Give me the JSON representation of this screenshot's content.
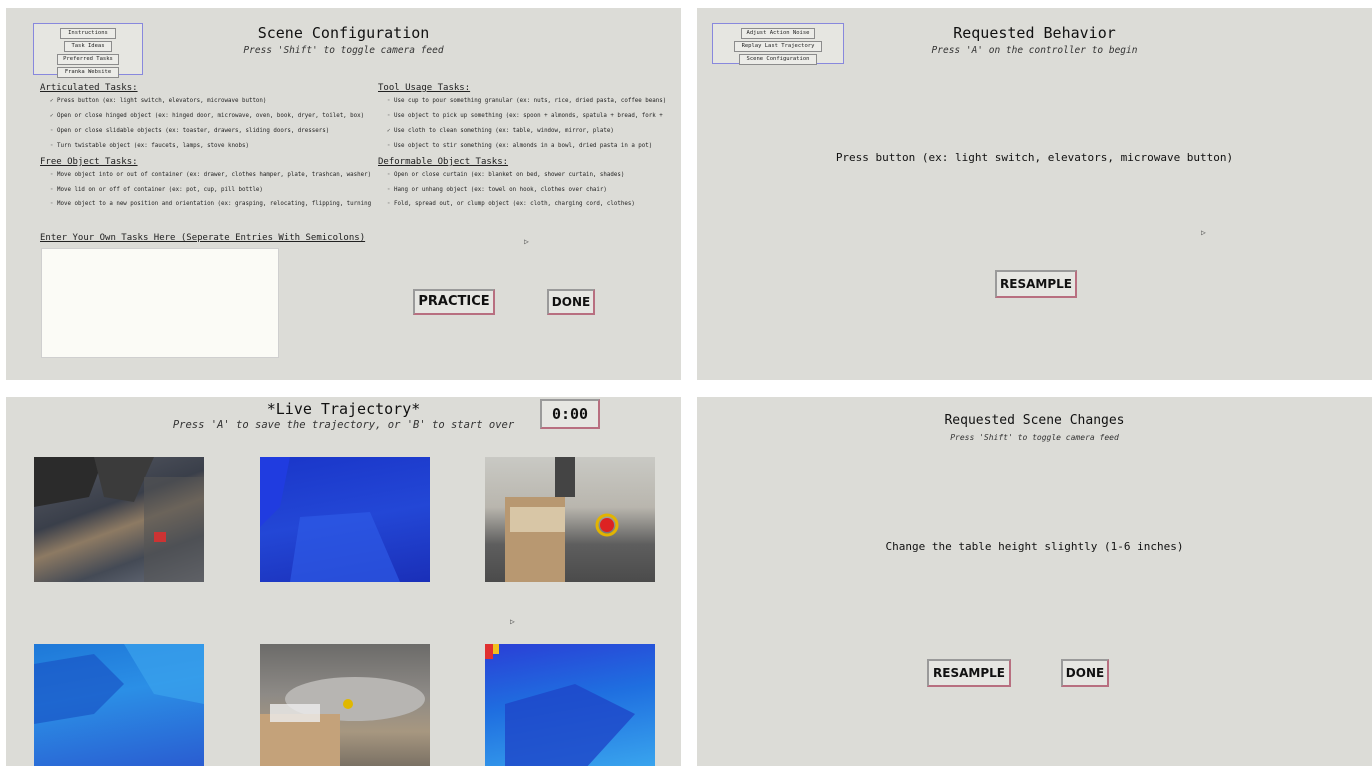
{
  "scene_config": {
    "title": "Scene Configuration",
    "subtitle": "Press 'Shift' to toggle camera feed",
    "nav": [
      "Instructions",
      "Task Ideas",
      "Preferred Tasks",
      "Franka Website"
    ],
    "articulated_header": "Articulated Tasks:",
    "articulated": [
      {
        "label": "Press button (ex: light switch, elevators, microwave button)",
        "checked": true
      },
      {
        "label": "Open or close hinged object (ex: hinged door, microwave, oven, book, dryer, toilet, box)",
        "checked": true
      },
      {
        "label": "Open or close slidable objects (ex: toaster, drawers, sliding doors, dressers)",
        "checked": false
      },
      {
        "label": "Turn twistable object (ex: faucets, lamps, stove knobs)",
        "checked": false
      }
    ],
    "free_header": "Free Object Tasks:",
    "free": [
      {
        "label": "Move object into or out of container (ex: drawer, clothes hamper, plate, trashcan, washer)",
        "checked": false
      },
      {
        "label": "Move lid on or off of container (ex: pot, cup, pill bottle)",
        "checked": false
      },
      {
        "label": "Move object to a new position and orientation (ex: grasping, relocating, flipping, turning",
        "checked": false
      }
    ],
    "tool_header": "Tool Usage Tasks:",
    "tool": [
      {
        "label": "Use cup to pour something granular (ex: nuts, rice, dried pasta, coffee beans)",
        "checked": false
      },
      {
        "label": "Use object to pick up something (ex: spoon + almonds, spatula + bread, fork +",
        "checked": false
      },
      {
        "label": "Use cloth to clean something (ex: table, window, mirror, plate)",
        "checked": true
      },
      {
        "label": "Use object to stir something (ex: almonds in a bowl, dried pasta in a pot)",
        "checked": false
      }
    ],
    "deformable_header": "Deformable Object Tasks:",
    "deformable": [
      {
        "label": "Open or close curtain (ex: blanket on bed, shower curtain, shades)",
        "checked": false
      },
      {
        "label": "Hang or unhang object (ex: towel on hook, clothes over chair)",
        "checked": false
      },
      {
        "label": "Fold, spread out, or clump object (ex: cloth, charging cord, clothes)",
        "checked": false
      }
    ],
    "custom_prompt": "Enter Your Own Tasks Here (Seperate Entries With Semicolons)",
    "practice_label": "PRACTICE",
    "done_label": "DONE"
  },
  "requested_behavior": {
    "nav": [
      "Adjust Action Noise",
      "Replay Last Trajectory",
      "Scene Configuration"
    ],
    "title": "Requested Behavior",
    "subtitle": "Press 'A' on the controller to begin",
    "task": "Press button (ex: light switch, elevators, microwave button)",
    "resample_label": "RESAMPLE"
  },
  "live_trajectory": {
    "title": "*Live Trajectory*",
    "subtitle": "Press 'A' to save the trajectory, or 'B' to start over",
    "timer": "0:00",
    "feeds": [
      "rgb",
      "depth",
      "rgb",
      "depth",
      "rgb",
      "depth"
    ]
  },
  "scene_changes": {
    "title": "Requested Scene Changes",
    "subtitle": "Press 'Shift' to toggle camera feed",
    "change": "Change the table height slightly (1-6 inches)",
    "resample_label": "RESAMPLE",
    "done_label": "DONE"
  },
  "colors": {
    "panel_bg": "#dcdcd7",
    "nav_border": "#8888dd",
    "button_accent": "#b86f80"
  }
}
